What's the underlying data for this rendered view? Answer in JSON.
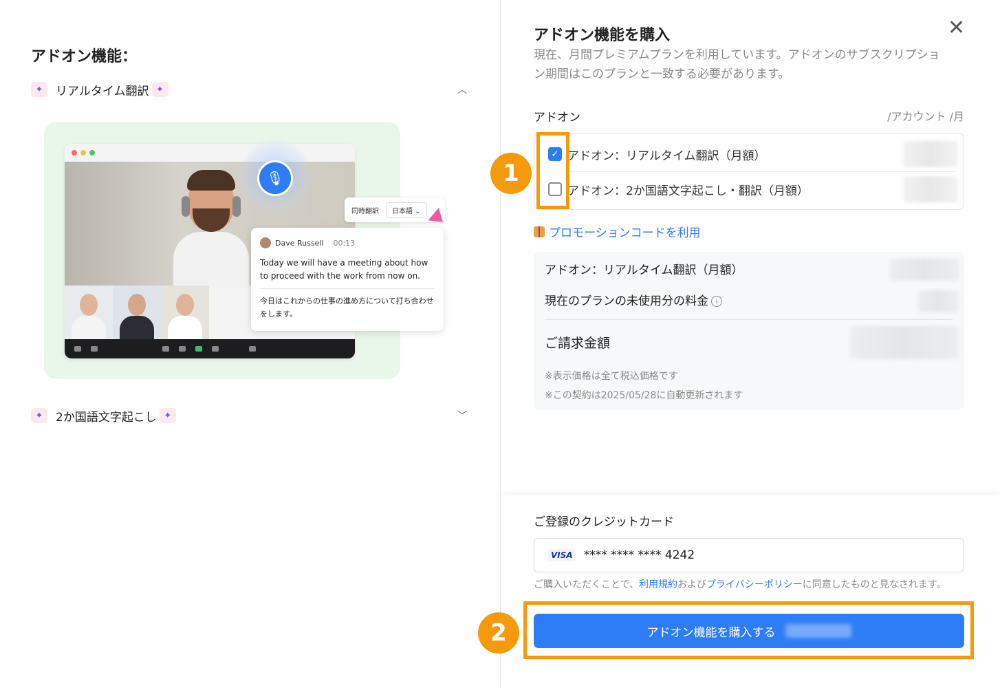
{
  "left": {
    "title": "アドオン機能：",
    "features": [
      {
        "label": "リアルタイム翻訳",
        "expanded": true,
        "chevron": "chevron-up-icon"
      },
      {
        "label": "2か国語文字起こし",
        "expanded": false,
        "chevron": "chevron-down-icon"
      }
    ],
    "illustration": {
      "translate_label": "同時翻訳",
      "language": "日本語",
      "speaker_name": "Dave Russell",
      "speaker_time": "00:13",
      "transcript_en": "Today we will have a meeting about how to proceed with the work from now on.",
      "transcript_jp": "今日はこれからの仕事の進め方について打ち合わせをします。"
    }
  },
  "right": {
    "title": "アドオン機能を購入",
    "close_icon": "close-icon",
    "description": "現在、月間プレミアムプランを利用しています。アドオンのサブスクリプション期間はこのプランと一致する必要があります。",
    "addon_header": "アドオン",
    "price_unit": "/アカウント /月",
    "addons": [
      {
        "label": "アドオン：リアルタイム翻訳（月額）",
        "checked": true
      },
      {
        "label": "アドオン：2か国語文字起こし・翻訳（月額）",
        "checked": false
      }
    ],
    "promo_label": "プロモーションコードを利用",
    "summary": {
      "line1": "アドオン：リアルタイム翻訳（月額）",
      "line2": "現在のプランの未使用分の料金",
      "total_label": "ご請求金額",
      "note1": "※表示価格は全て税込価格です",
      "note2": "※この契約は2025/05/28に自動更新されます"
    },
    "card_label": "ご登録のクレジットカード",
    "card_brand": "VISA",
    "card_number": "**** **** **** 4242",
    "terms_prefix": "ご購入いただくことで、",
    "terms_link1": "利用規約",
    "terms_mid": "および",
    "terms_link2": "プライバシーポリシー",
    "terms_suffix": "に同意したものと見なされます。",
    "buy_button": "アドオン機能を購入する"
  },
  "annotations": {
    "badge1": "1",
    "badge2": "2",
    "highlight_color": "#f59a0c"
  },
  "colors": {
    "accent": "#2f7df6",
    "panel_bg": "#f7f8f9",
    "illustration_bg": "#e9f6ea"
  }
}
